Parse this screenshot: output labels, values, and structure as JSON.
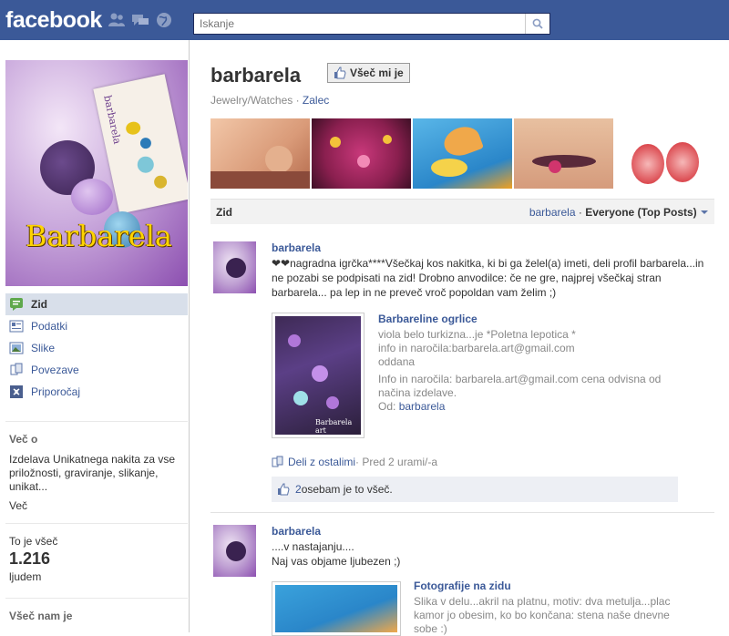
{
  "topbar": {
    "logo": "facebook",
    "search": {
      "placeholder": "Iskanje",
      "value": "Iskanje"
    }
  },
  "profile": {
    "picture_text": "Barbarela",
    "card_text": "barbarela"
  },
  "leftnav": {
    "items": [
      {
        "label": "Zid",
        "icon": "wall-icon",
        "active": true
      },
      {
        "label": "Podatki",
        "icon": "info-icon"
      },
      {
        "label": "Slike",
        "icon": "photos-icon"
      },
      {
        "label": "Povezave",
        "icon": "links-icon"
      },
      {
        "label": "Priporočaj",
        "icon": "recommend-icon"
      }
    ]
  },
  "about": {
    "heading": "Več o",
    "text": "Izdelava Unikatnega nakita za vse priložnosti, graviranje, slikanje, unikat...",
    "more": "Več"
  },
  "likes": {
    "heading": "To je všeč",
    "count": "1.216",
    "unit": "ljudem"
  },
  "we_like": {
    "heading": "Všeč nam je"
  },
  "page": {
    "title": "barbarela",
    "like_button": "Všeč mi je",
    "category": "Jewelry/Watches",
    "dot": " · ",
    "fan_link": "Zalec"
  },
  "wall": {
    "label": "Zid",
    "filter_name": "barbarela",
    "filter_sep": " · ",
    "filter_value": "Everyone (Top Posts)"
  },
  "posts": [
    {
      "author": "barbarela",
      "text": "❤❤nagradna igrčka****Všečkaj kos nakitka, ki bi ga želel(a) imeti, deli profil barbarela...in ne pozabi se podpisati na zid! Drobno anvodilce: če ne gre, najprej všečkaj stran barbarela... pa lep in ne preveč vroč popoldan vam želim ;)",
      "attachment": {
        "title": "Barbareline ogrlice",
        "lines": [
          "viola belo turkizna...je *Poletna lepotica *",
          "info in naročila:barbarela.art@gmail.com",
          "oddana"
        ],
        "description": "Info in naročila: barbarela.art@gmail.com cena odvisna od načina izdelave.",
        "from_label": "Od: ",
        "from_link": "barbarela",
        "image_caption": "Barbarela art"
      },
      "share": "Deli z ostalimi",
      "time": " · Pred 2 urami/-a",
      "likes_count": "2",
      "likes_text": " osebam je to všeč."
    },
    {
      "author": "barbarela",
      "text_line1": "....v nastajanju....",
      "text_line2": "Naj vas objame ljubezen ;)",
      "attachment": {
        "title": "Fotografije na zidu",
        "description": "Slika v delu...akril na platnu, motiv: dva metulja...plac kamor jo obesim, ko bo končana: stena naše dnevne sobe :)"
      }
    }
  ],
  "colors": {
    "brand": "#3b5998",
    "nav_active": "#d8dfea",
    "likebox": "#edeff4"
  }
}
